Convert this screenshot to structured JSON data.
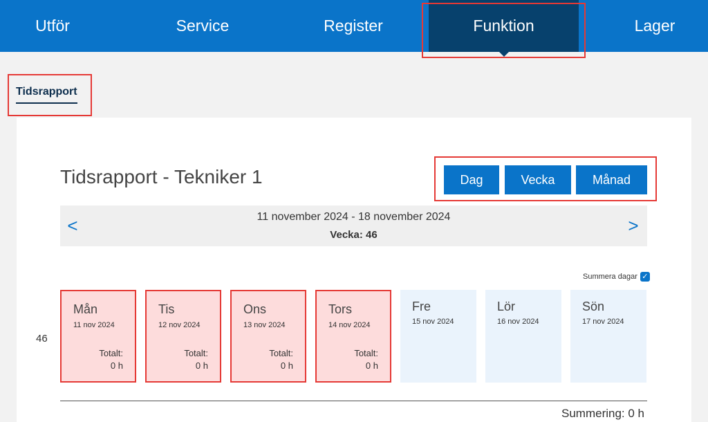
{
  "nav": {
    "items": [
      {
        "label": "Utför",
        "active": false
      },
      {
        "label": "Service",
        "active": false
      },
      {
        "label": "Register",
        "active": false
      },
      {
        "label": "Funktion",
        "active": true
      },
      {
        "label": "Lager",
        "active": false
      }
    ]
  },
  "page_tab": "Tidsrapport",
  "title": "Tidsrapport - Tekniker 1",
  "view_buttons": [
    "Dag",
    "Vecka",
    "Månad"
  ],
  "week_nav": {
    "prev": "<",
    "next": ">",
    "range": "11 november 2024 - 18 november 2024",
    "week": "Vecka: 46"
  },
  "summarize_days": {
    "label": "Summera dagar",
    "checked": true
  },
  "week_number": "46",
  "days": [
    {
      "name": "Mån",
      "date": "11 nov 2024",
      "total_label": "Totalt:",
      "total": "0 h",
      "flagged": true
    },
    {
      "name": "Tis",
      "date": "12 nov 2024",
      "total_label": "Totalt:",
      "total": "0 h",
      "flagged": true
    },
    {
      "name": "Ons",
      "date": "13 nov 2024",
      "total_label": "Totalt:",
      "total": "0 h",
      "flagged": true
    },
    {
      "name": "Tors",
      "date": "14 nov 2024",
      "total_label": "Totalt:",
      "total": "0 h",
      "flagged": true
    },
    {
      "name": "Fre",
      "date": "15 nov 2024",
      "flagged": false
    },
    {
      "name": "Lör",
      "date": "16 nov 2024",
      "flagged": false
    },
    {
      "name": "Sön",
      "date": "17 nov 2024",
      "flagged": false
    }
  ],
  "summary": "Summering: 0 h",
  "colors": {
    "primary": "#0a74c9",
    "nav_active": "#07416d",
    "highlight": "#e53935",
    "flagged_bg": "#fddcdc",
    "day_bg": "#eaf3fc"
  }
}
